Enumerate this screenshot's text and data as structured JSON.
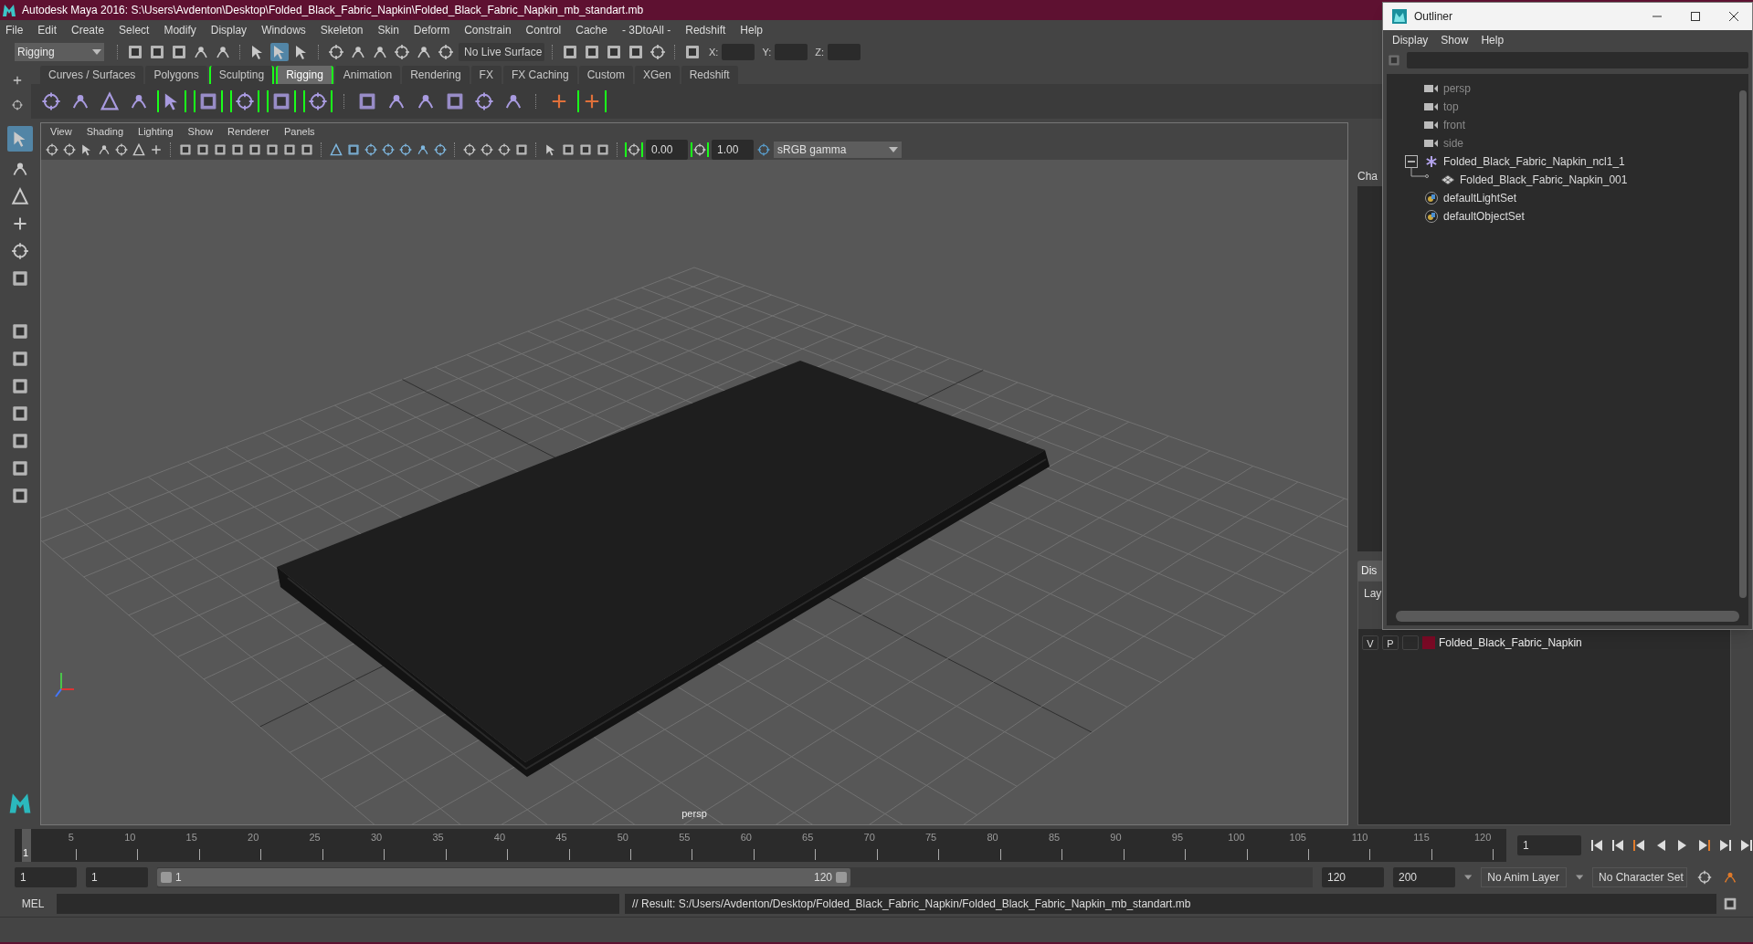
{
  "window": {
    "title": "Autodesk Maya 2016: S:\\Users\\Avdenton\\Desktop\\Folded_Black_Fabric_Napkin\\Folded_Black_Fabric_Napkin_mb_standart.mb"
  },
  "menu_bar": [
    "File",
    "Edit",
    "Create",
    "Select",
    "Modify",
    "Display",
    "Windows",
    "Skeleton",
    "Skin",
    "Deform",
    "Constrain",
    "Control",
    "Cache",
    "- 3DtoAll -",
    "Redshift",
    "Help"
  ],
  "status_line": {
    "menu_set": "Rigging",
    "live_surface": "No Live Surface",
    "coords": [
      "X:",
      "Y:",
      "Z:"
    ]
  },
  "shelf_tabs": [
    {
      "label": "Curves / Surfaces",
      "selected": false,
      "marked": false
    },
    {
      "label": "Polygons",
      "selected": false,
      "marked": false
    },
    {
      "label": "Sculpting",
      "selected": false,
      "marked": true
    },
    {
      "label": "Rigging",
      "selected": true,
      "marked": true
    },
    {
      "label": "Animation",
      "selected": false,
      "marked": false
    },
    {
      "label": "Rendering",
      "selected": false,
      "marked": false
    },
    {
      "label": "FX",
      "selected": false,
      "marked": false
    },
    {
      "label": "FX Caching",
      "selected": false,
      "marked": false
    },
    {
      "label": "Custom",
      "selected": false,
      "marked": false
    },
    {
      "label": "XGen",
      "selected": false,
      "marked": false
    },
    {
      "label": "Redshift",
      "selected": false,
      "marked": false
    }
  ],
  "viewport": {
    "menus": [
      "View",
      "Shading",
      "Lighting",
      "Show",
      "Renderer",
      "Panels"
    ],
    "exposure": "0.00",
    "gamma": "1.00",
    "color_space": "sRGB gamma",
    "camera_label": "persp"
  },
  "side_panel": {
    "channel_box_tab": "Cha",
    "display_tab": "Dis",
    "layers_menu": "Lay",
    "layers": [
      {
        "visible": "V",
        "playback": "P",
        "color": "#7a0a25",
        "name": "Folded_Black_Fabric_Napkin"
      }
    ]
  },
  "outliner": {
    "title": "Outliner",
    "menus": [
      "Display",
      "Show",
      "Help"
    ],
    "items": [
      {
        "kind": "camera",
        "label": "persp",
        "dimmed": true
      },
      {
        "kind": "camera",
        "label": "top",
        "dimmed": true
      },
      {
        "kind": "camera",
        "label": "front",
        "dimmed": true
      },
      {
        "kind": "camera",
        "label": "side",
        "dimmed": true
      },
      {
        "kind": "group",
        "label": "Folded_Black_Fabric_Napkin_ncl1_1",
        "dimmed": false,
        "expanded": true,
        "children": [
          {
            "kind": "mesh",
            "label": "Folded_Black_Fabric_Napkin_001",
            "dimmed": false
          }
        ]
      },
      {
        "kind": "set",
        "label": "defaultLightSet",
        "dimmed": false
      },
      {
        "kind": "set",
        "label": "defaultObjectSet",
        "dimmed": false
      }
    ]
  },
  "timeline": {
    "level": 0,
    "current_marker": "1",
    "ticks": [
      "5",
      "10",
      "15",
      "20",
      "25",
      "30",
      "35",
      "40",
      "45",
      "50",
      "55",
      "60",
      "65",
      "70",
      "75",
      "80",
      "85",
      "90",
      "95",
      "100",
      "105",
      "110",
      "115",
      "120"
    ],
    "current_frame": "1"
  },
  "range": {
    "level": 0.6,
    "start": "1",
    "playback_start": "1",
    "slider_start": "1",
    "slider_end": "120",
    "playback_end": "120",
    "end": "200",
    "anim_layer": "No Anim Layer",
    "character_set": "No Character Set"
  },
  "command_line": {
    "language": "MEL",
    "result": "// Result: S:/Users/Avdenton/Desktop/Folded_Black_Fabric_Napkin/Folded_Black_Fabric_Napkin_mb_standart.mb"
  }
}
